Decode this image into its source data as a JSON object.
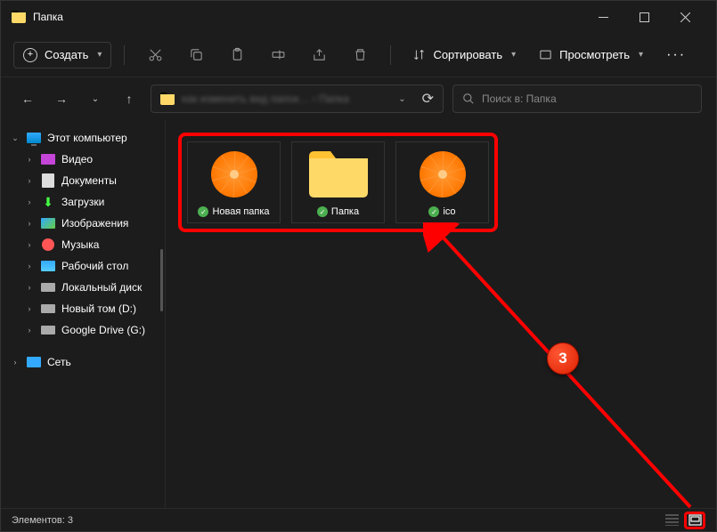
{
  "titlebar": {
    "title": "Папка"
  },
  "toolbar": {
    "create": "Создать",
    "sort": "Сортировать",
    "view": "Просмотреть"
  },
  "address": {
    "path_blurred": "как изменить вид папок… › Папка",
    "search_placeholder": "Поиск в: Папка"
  },
  "sidebar": {
    "root": "Этот компьютер",
    "items": [
      {
        "label": "Видео"
      },
      {
        "label": "Документы"
      },
      {
        "label": "Загрузки"
      },
      {
        "label": "Изображения"
      },
      {
        "label": "Музыка"
      },
      {
        "label": "Рабочий стол"
      },
      {
        "label": "Локальный диск"
      },
      {
        "label": "Новый том (D:)"
      },
      {
        "label": "Google Drive (G:)"
      }
    ],
    "network": "Сеть"
  },
  "files": [
    {
      "name": "Новая папка",
      "type": "orange"
    },
    {
      "name": "Папка",
      "type": "folder"
    },
    {
      "name": "ico",
      "type": "orange"
    }
  ],
  "statusbar": {
    "count_label": "Элементов:",
    "count": "3"
  },
  "annotation": {
    "step": "3"
  }
}
